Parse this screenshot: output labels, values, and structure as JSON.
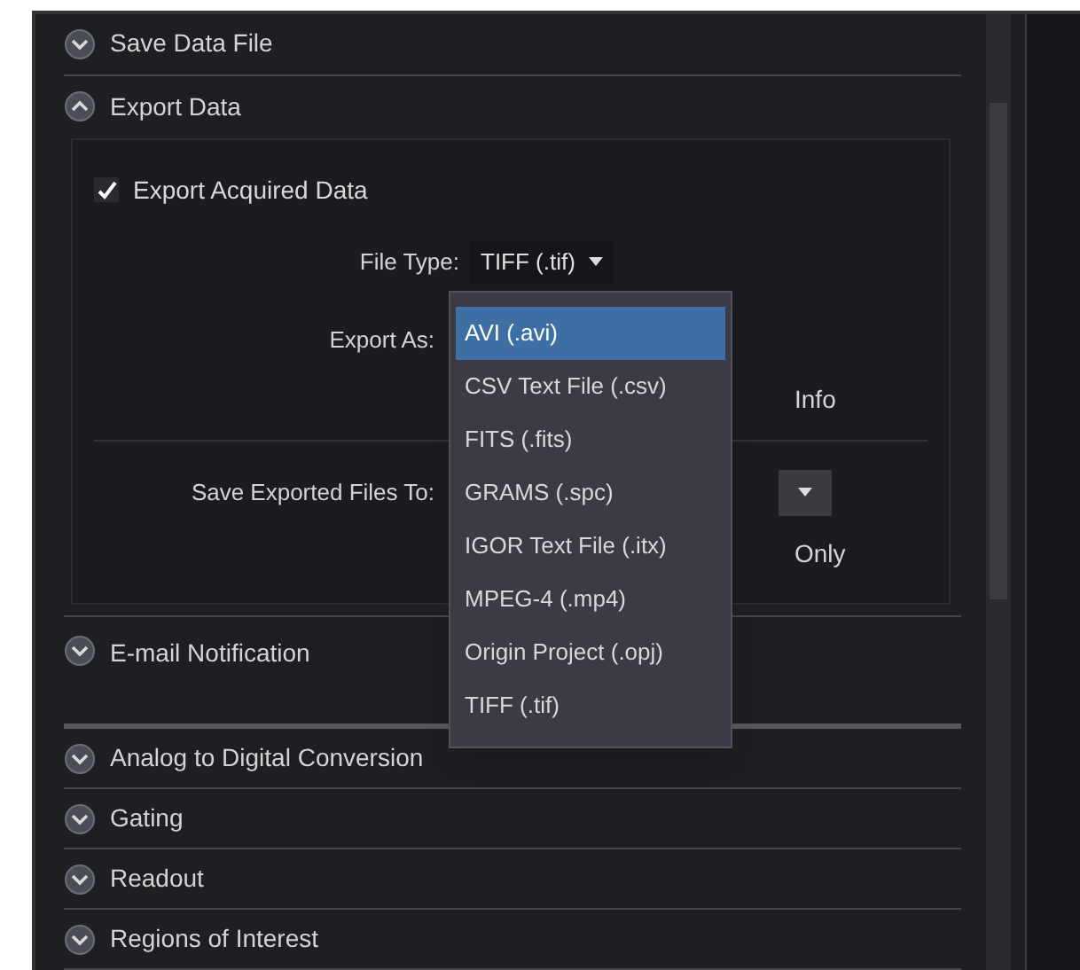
{
  "sections": [
    {
      "title": "Save Data File",
      "expanded": false
    },
    {
      "title": "Export Data",
      "expanded": true
    },
    {
      "title": "E-mail Notification",
      "expanded": false
    },
    {
      "title": "Analog to Digital Conversion",
      "expanded": false
    },
    {
      "title": "Gating",
      "expanded": false
    },
    {
      "title": "Readout",
      "expanded": false
    },
    {
      "title": "Regions of Interest",
      "expanded": false
    }
  ],
  "export": {
    "export_acquired": {
      "label": "Export Acquired Data",
      "checked": true
    },
    "file_type_label": "File Type:",
    "file_type_value": "TIFF (.tif)",
    "export_as_label": "Export As:",
    "info_text": "Info",
    "save_to_label": "Save Exported Files To:",
    "only_text": "Only"
  },
  "dropdown": [
    {
      "label": "AVI (.avi)",
      "selected": true
    },
    {
      "label": "CSV Text File (.csv)",
      "selected": false
    },
    {
      "label": "FITS (.fits)",
      "selected": false
    },
    {
      "label": "GRAMS (.spc)",
      "selected": false
    },
    {
      "label": "IGOR Text File (.itx)",
      "selected": false
    },
    {
      "label": "MPEG-4 (.mp4)",
      "selected": false
    },
    {
      "label": "Origin Project (.opj)",
      "selected": false
    },
    {
      "label": "TIFF (.tif)",
      "selected": false
    }
  ]
}
